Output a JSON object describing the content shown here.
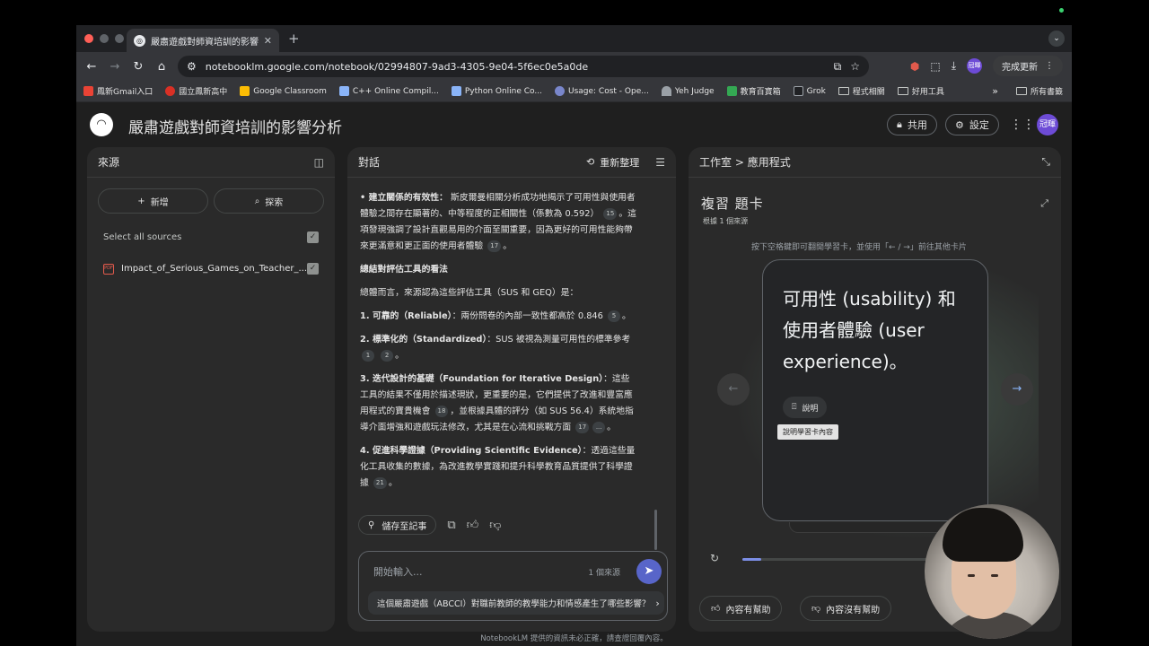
{
  "browser": {
    "tab_title": "嚴肅遊戲對師資培訓的影響分析",
    "url": "notebooklm.google.com/notebook/02994807-9ad3-4305-9e04-5f6ec0e5a0de",
    "profile": "冠暉",
    "update_label": "完成更新",
    "bookmarks": [
      "鳳新Gmail入口",
      "國立鳳新高中",
      "Google Classroom",
      "C++ Online Compil...",
      "Python Online Co...",
      "Usage: Cost - Ope...",
      "Yeh Judge",
      "教育百寶箱",
      "Grok",
      "程式相關",
      "好用工具"
    ],
    "bookmarks_more": "»",
    "all_bookmarks": "所有書籤"
  },
  "app": {
    "title": "嚴肅遊戲對師資培訓的影響分析",
    "share_label": "共用",
    "settings_label": "設定",
    "avatar": "冠暉"
  },
  "sources": {
    "header": "來源",
    "add_label": "新增",
    "explore_label": "探索",
    "select_all": "Select all sources",
    "items": [
      {
        "name": "Impact_of_Serious_Games_on_Teacher_..."
      }
    ]
  },
  "chat": {
    "header": "對話",
    "refresh_label": "重新整理",
    "p1_bold": "• 建立關係的有效性：",
    "p1_text": "斯皮爾曼相關分析成功地揭示了可用性與使用者體驗之間存在顯著的、中等程度的正相關性（係數為 0.592）",
    "p1_cite1": "15",
    "p1_text2": "。這項發現強調了設計直觀易用的介面至關重要，因為更好的可用性能夠帶來更滿意和更正面的使用者體驗",
    "p1_cite2": "17",
    "p1_end": "。",
    "h2": "總結對評估工具的看法",
    "p2": "總體而言，來源認為這些評估工具（SUS 和 GEQ）是：",
    "i1_bold": "1. 可靠的（Reliable）",
    "i1_text": "：兩份問卷的內部一致性都高於 0.846",
    "i1_cite": "5",
    "i2_bold": "2. 標準化的（Standardized）",
    "i2_text": "：SUS 被視為測量可用性的標準參考",
    "i2_cite1": "1",
    "i2_cite2": "2",
    "i3_bold": "3. 迭代設計的基礎（Foundation for Iterative Design）",
    "i3_text": "：這些工具的結果不僅用於描述現狀，更重要的是，它們提供了改進和豐富應用程式的寶貴機會",
    "i3_cite1": "18",
    "i3_text2": "，並根據具體的評分（如 SUS 56.4）系統地指導介面增強和遊戲玩法修改，尤其是在心流和挑戰方面",
    "i3_cite2": "17",
    "i3_cite3": "...",
    "i4_bold": "4. 促進科學證據（Providing Scientific Evidence）",
    "i4_text": "：透過這些量化工具收集的數據，為改進教學實踐和提升科學教育品質提供了科學證據",
    "i4_cite": "21",
    "period": "。",
    "save_note": "儲存至記事",
    "input_placeholder": "開始輸入...",
    "source_count": "1 個來源",
    "suggestion": "這個嚴肅遊戲（ABCCI）對職前教師的教學能力和情感產生了哪些影響？"
  },
  "studio": {
    "breadcrumb_root": "工作室",
    "breadcrumb_sep": ">",
    "breadcrumb_leaf": "應用程式",
    "title": "複習 題卡",
    "subtitle": "根據 1 個來源",
    "hint": "按下空格鍵即可翻開學習卡，並使用「← / →」前往其他卡片",
    "card_text": "可用性 (usability) 和使用者體驗 (user experience)。",
    "explain_label": "說明",
    "tooltip": "說明學習卡內容",
    "progress": 0.08,
    "helpful_label": "內容有幫助",
    "not_helpful_label": "內容沒有幫助"
  },
  "footer": "NotebookLM 提供的資訊未必正確，請查證回覆內容。",
  "colors": {
    "accent": "#5865c9",
    "progress": "#7c8ee6",
    "panel": "#2a2a2a",
    "background": "#1f1f1f"
  }
}
